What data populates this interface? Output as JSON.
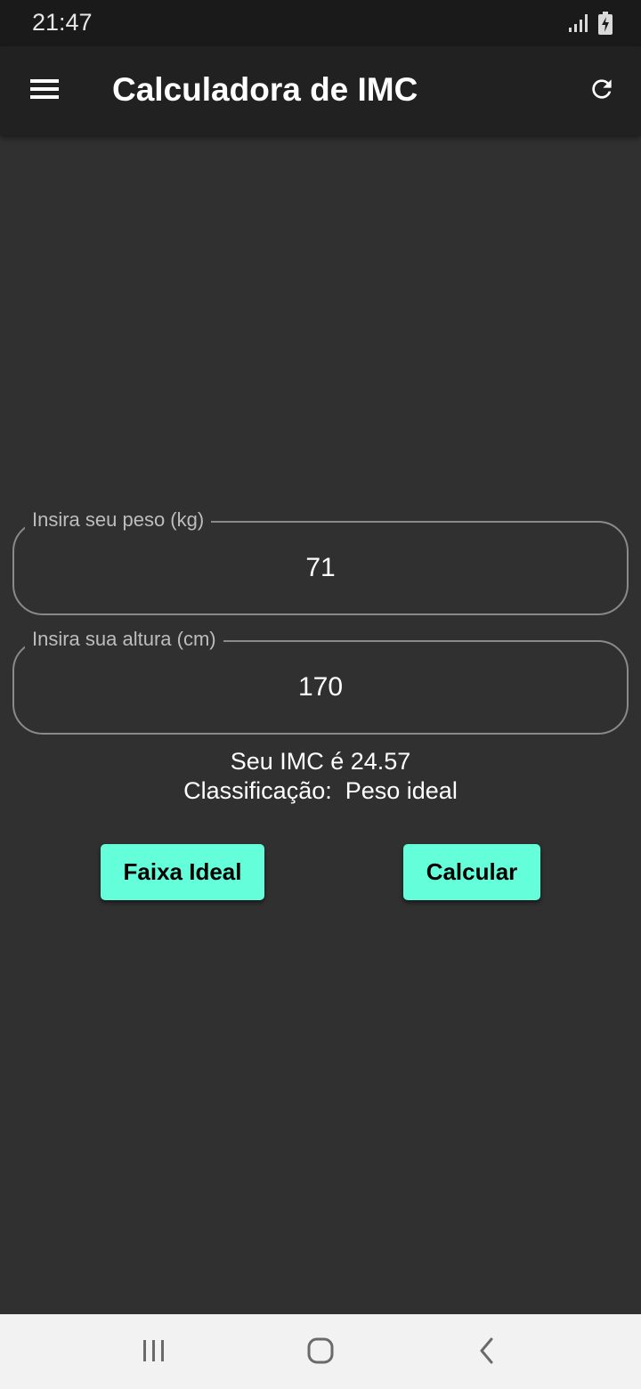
{
  "status_bar": {
    "time": "21:47",
    "icons": [
      "signal-icon",
      "battery-charging-icon"
    ]
  },
  "app_bar": {
    "title": "Calculadora de IMC",
    "menu_icon": "menu-icon",
    "refresh_icon": "refresh-icon"
  },
  "form": {
    "weight": {
      "label": "Insira seu peso (kg)",
      "value": "71"
    },
    "height": {
      "label": "Insira sua altura (cm)",
      "value": "170"
    }
  },
  "result": {
    "line1": "Seu IMC é 24.57",
    "line2": "Classificação:  Peso ideal"
  },
  "buttons": {
    "ideal_label": "Faixa Ideal",
    "calc_label": "Calcular"
  },
  "nav_bar": {
    "icons": [
      "recents-icon",
      "home-icon",
      "back-icon"
    ]
  },
  "colors": {
    "background": "#303030",
    "app_bar": "#212121",
    "accent": "#64ffda",
    "nav_bar": "#f2f2f2"
  }
}
